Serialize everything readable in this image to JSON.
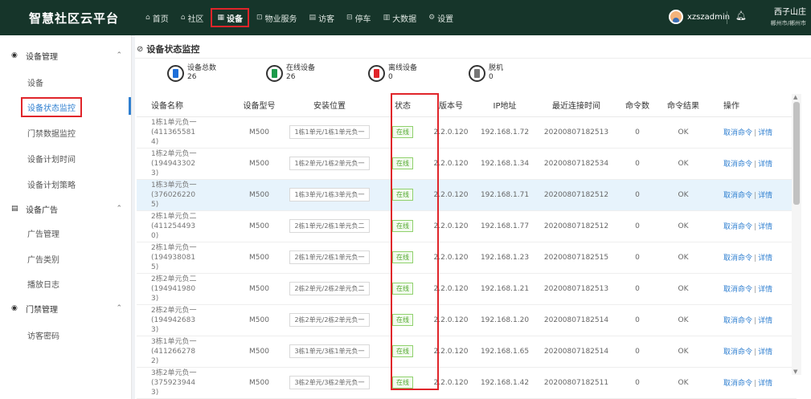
{
  "app": {
    "brand": "智慧社区云平台"
  },
  "nav": [
    {
      "icon": "⌂",
      "label": "首页"
    },
    {
      "icon": "⌂",
      "label": "社区"
    },
    {
      "icon": "▦",
      "label": "设备",
      "active": true
    },
    {
      "icon": "⊡",
      "label": "物业服务"
    },
    {
      "icon": "▤",
      "label": "访客"
    },
    {
      "icon": "⊟",
      "label": "停车"
    },
    {
      "icon": "▥",
      "label": "大数据"
    },
    {
      "icon": "⚙",
      "label": "设置"
    }
  ],
  "user": {
    "name": "xzszadmin",
    "location_line1": "西子山庄",
    "location_line2": "郴州市/郴州市"
  },
  "sidebar": {
    "groups": [
      {
        "label": "设备管理",
        "icon": "◉",
        "items": [
          "设备",
          "设备状态监控",
          "门禁数据监控",
          "设备计划时间",
          "设备计划策略"
        ]
      },
      {
        "label": "设备广告",
        "icon": "▤",
        "items": [
          "广告管理",
          "广告类别",
          "播放日志"
        ]
      },
      {
        "label": "门禁管理",
        "icon": "◉",
        "items": [
          "访客密码"
        ]
      }
    ],
    "active_item": "设备状态监控"
  },
  "page": {
    "title": "设备状态监控"
  },
  "stats": [
    {
      "label": "设备总数",
      "value": "26",
      "color": "#1e6fd9"
    },
    {
      "label": "在线设备",
      "value": "26",
      "color": "#1c9a4a"
    },
    {
      "label": "离线设备",
      "value": "0",
      "color": "#e0252a"
    },
    {
      "label": "脱机",
      "value": "0",
      "color": "#777777"
    }
  ],
  "table": {
    "headers": [
      "设备名称",
      "设备型号",
      "安装位置",
      "状态",
      "版本号",
      "IP地址",
      "最近连接时间",
      "命令数",
      "命令结果",
      "操作"
    ],
    "rows": [
      {
        "name_l1": "1栋1单元负一(411365581",
        "name_l2": "4)",
        "model": "M500",
        "location": "1栋1单元/1栋1单元负一",
        "status": "在线",
        "version": "2.2.0.120",
        "ip": "192.168.1.72",
        "time": "20200807182513",
        "cmd": "0",
        "result": "OK"
      },
      {
        "name_l1": "1栋2单元负一(194943302",
        "name_l2": "3)",
        "model": "M500",
        "location": "1栋2单元/1栋2单元负一",
        "status": "在线",
        "version": "2.2.0.120",
        "ip": "192.168.1.34",
        "time": "20200807182534",
        "cmd": "0",
        "result": "OK"
      },
      {
        "name_l1": "1栋3单元负一(376026220",
        "name_l2": "5)",
        "model": "M500",
        "location": "1栋3单元/1栋3单元负一",
        "status": "在线",
        "version": "2.2.0.120",
        "ip": "192.168.1.71",
        "time": "20200807182512",
        "cmd": "0",
        "result": "OK",
        "highlight": true
      },
      {
        "name_l1": "2栋1单元负二(411254493",
        "name_l2": "0)",
        "model": "M500",
        "location": "2栋1单元/2栋1单元负二",
        "status": "在线",
        "version": "2.2.0.120",
        "ip": "192.168.1.77",
        "time": "20200807182512",
        "cmd": "0",
        "result": "OK"
      },
      {
        "name_l1": "2栋1单元负一(194938081",
        "name_l2": "5)",
        "model": "M500",
        "location": "2栋1单元/2栋1单元负一",
        "status": "在线",
        "version": "2.2.0.120",
        "ip": "192.168.1.23",
        "time": "20200807182515",
        "cmd": "0",
        "result": "OK"
      },
      {
        "name_l1": "2栋2单元负二(194941980",
        "name_l2": "3)",
        "model": "M500",
        "location": "2栋2单元/2栋2单元负二",
        "status": "在线",
        "version": "2.2.0.120",
        "ip": "192.168.1.21",
        "time": "20200807182513",
        "cmd": "0",
        "result": "OK"
      },
      {
        "name_l1": "2栋2单元负一(194942683",
        "name_l2": "3)",
        "model": "M500",
        "location": "2栋2单元/2栋2单元负一",
        "status": "在线",
        "version": "2.2.0.120",
        "ip": "192.168.1.20",
        "time": "20200807182514",
        "cmd": "0",
        "result": "OK"
      },
      {
        "name_l1": "3栋1单元负一(411266278",
        "name_l2": "2)",
        "model": "M500",
        "location": "3栋1单元/3栋1单元负一",
        "status": "在线",
        "version": "2.2.0.120",
        "ip": "192.168.1.65",
        "time": "20200807182514",
        "cmd": "0",
        "result": "OK"
      },
      {
        "name_l1": "3栋2单元负一(375923944",
        "name_l2": "3)",
        "model": "M500",
        "location": "3栋2单元/3栋2单元负一",
        "status": "在线",
        "version": "2.2.0.120",
        "ip": "192.168.1.42",
        "time": "20200807182511",
        "cmd": "0",
        "result": "OK"
      }
    ],
    "op_cancel": "取消命令",
    "op_sep": "|",
    "op_detail": "详情"
  }
}
